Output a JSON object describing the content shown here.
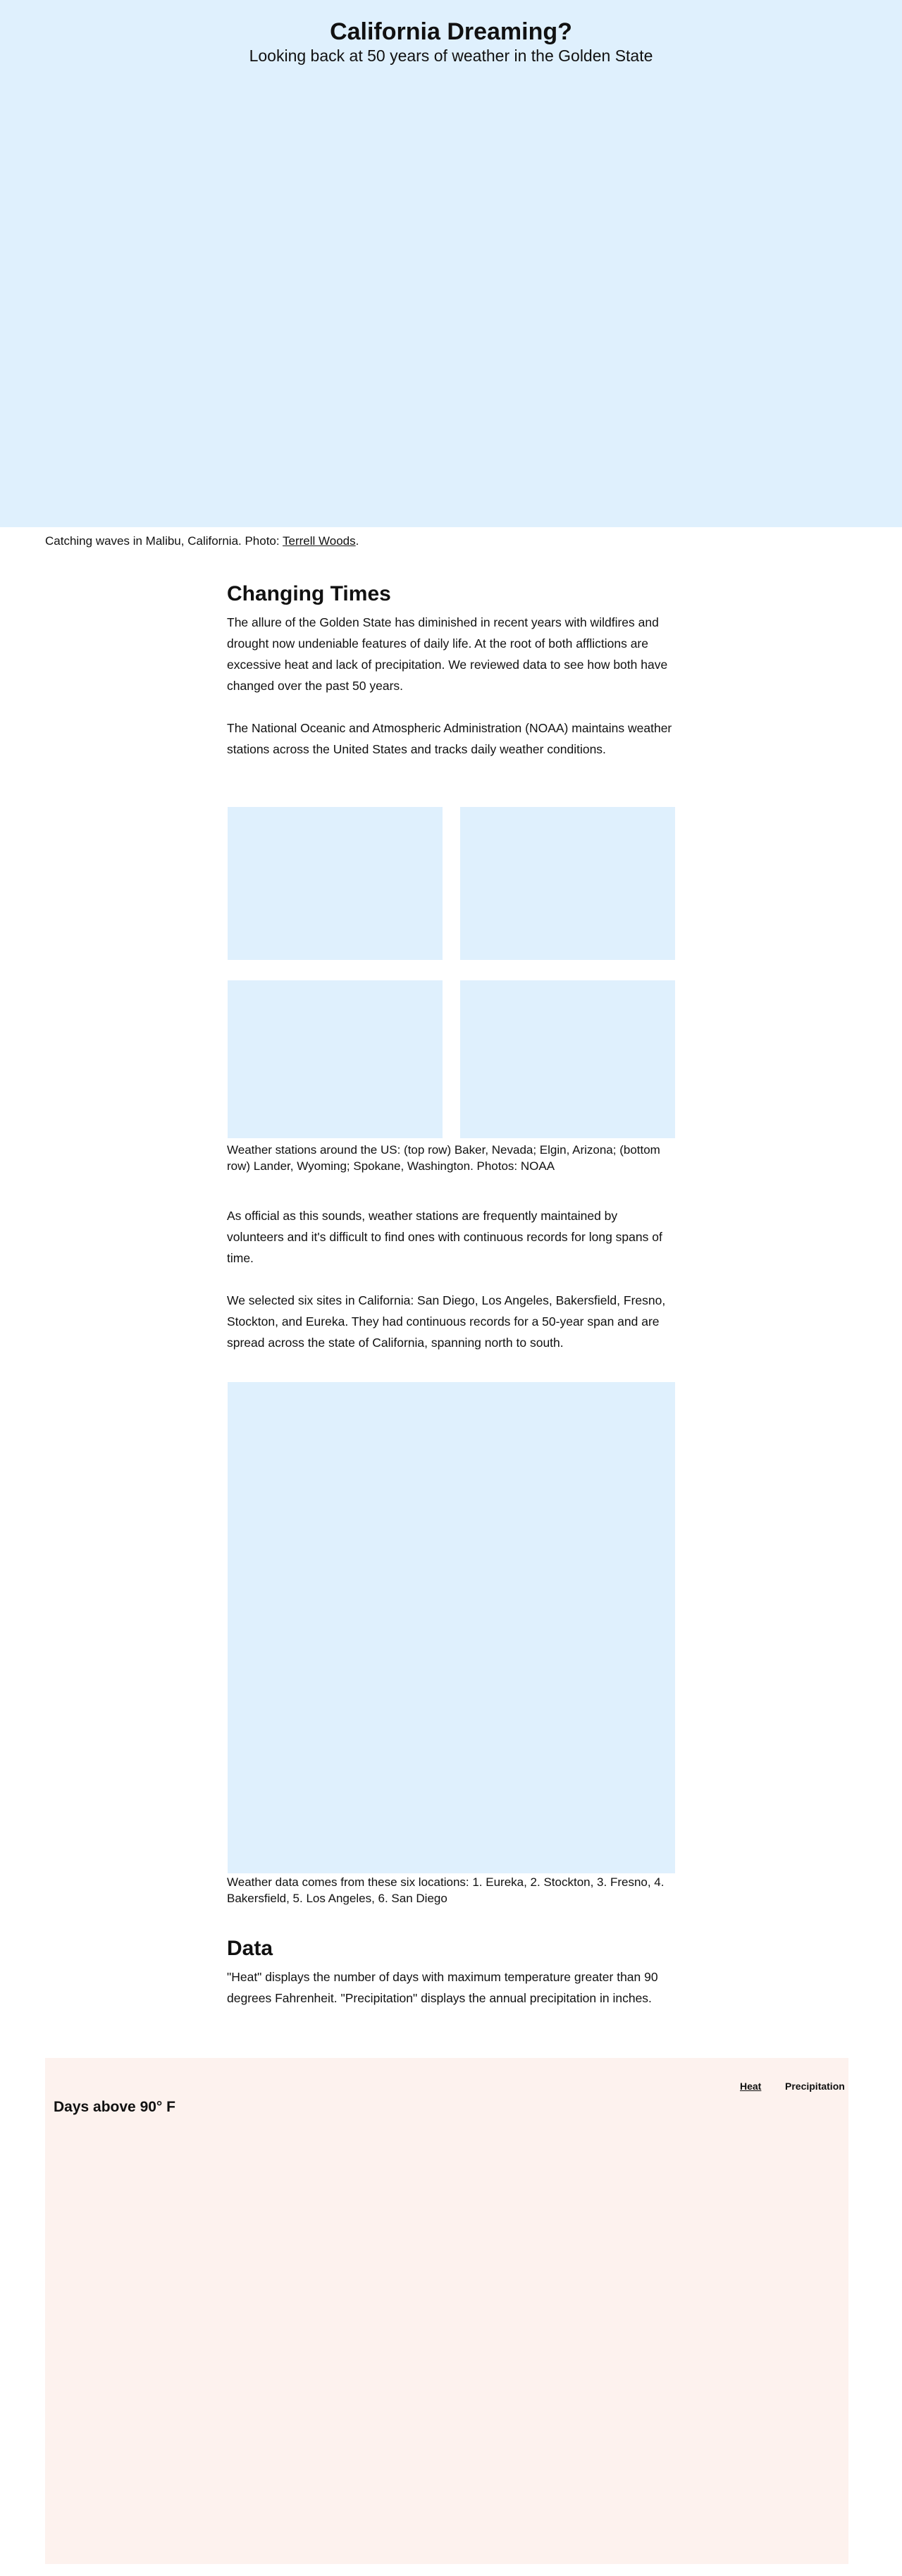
{
  "hero": {
    "title": "California Dreaming?",
    "subtitle": "Looking back at 50 years of weather in the Golden State",
    "caption_prefix": "Catching waves in Malibu, California. Photo: ",
    "caption_credit": "Terrell Woods",
    "caption_suffix": "."
  },
  "changing_times": {
    "title": "Changing Times",
    "paragraphs": [
      "The allure of the Golden State has diminished in recent years with wildfires and drought now undeniable features of daily life. At the root of both afflictions are excessive heat and lack of precipitation. We reviewed data to see how both have changed over the past 50 years.",
      "The National Oceanic and Atmospheric Administration (NOAA) maintains weather stations across the United States and tracks daily weather conditions."
    ]
  },
  "stations": {
    "caption": "Weather stations around the US: (top row) Baker, Nevada; Elgin, Arizona; (bottom row) Lander, Wyoming; Spokane, Washington. Photos: NOAA",
    "paragraphs": [
      "As official as this sounds, weather stations are frequently maintained by volunteers and it's difficult to find ones with continuous records for long spans of time.",
      "We selected six sites in California: San Diego, Los Angeles, Bakersfield, Fresno, Stockton, and Eureka. They had continuous records for a 50-year span and are spread across the state of California, spanning north to south."
    ]
  },
  "map": {
    "caption": "Weather data comes from these six locations: 1. Eureka, 2. Stockton, 3. Fresno, 4. Bakersfield, 5. Los Angeles, 6. San Diego"
  },
  "data_section": {
    "title": "Data",
    "paragraph": "\"Heat\" displays the number of days with maximum temperature greater than 90 degrees Fahrenheit. \"Precipitation\" displays the annual precipitation in inches."
  },
  "chart": {
    "title": "Days above 90° F",
    "tabs": [
      "Heat",
      "Precipitation"
    ],
    "active_tab": "Heat"
  },
  "colors": {
    "image_placeholder": "#dff0fd",
    "chart_background": "#fdf2ee"
  }
}
